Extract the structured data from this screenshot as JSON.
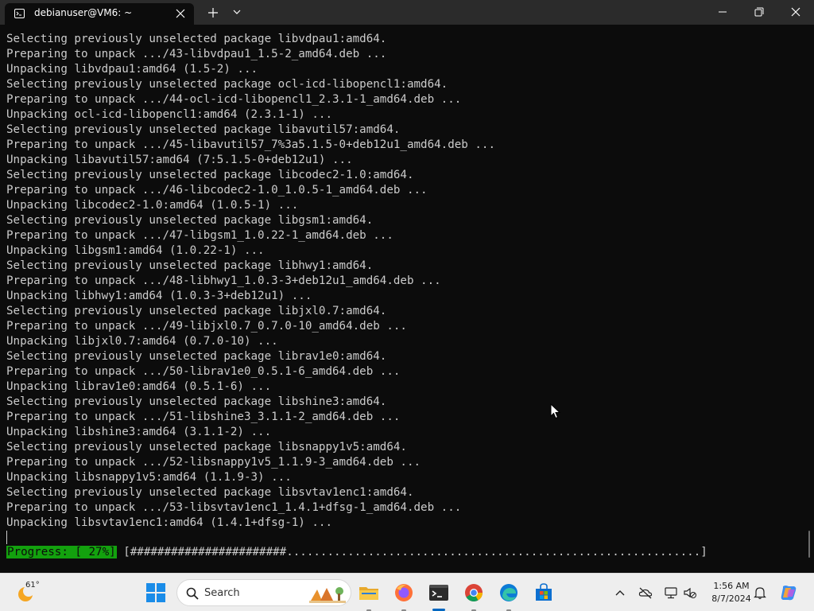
{
  "window": {
    "tab_title": "debianuser@VM6: ~"
  },
  "terminal": {
    "lines": [
      "Selecting previously unselected package libvdpau1:amd64.",
      "Preparing to unpack .../43-libvdpau1_1.5-2_amd64.deb ...",
      "Unpacking libvdpau1:amd64 (1.5-2) ...",
      "Selecting previously unselected package ocl-icd-libopencl1:amd64.",
      "Preparing to unpack .../44-ocl-icd-libopencl1_2.3.1-1_amd64.deb ...",
      "Unpacking ocl-icd-libopencl1:amd64 (2.3.1-1) ...",
      "Selecting previously unselected package libavutil57:amd64.",
      "Preparing to unpack .../45-libavutil57_7%3a5.1.5-0+deb12u1_amd64.deb ...",
      "Unpacking libavutil57:amd64 (7:5.1.5-0+deb12u1) ...",
      "Selecting previously unselected package libcodec2-1.0:amd64.",
      "Preparing to unpack .../46-libcodec2-1.0_1.0.5-1_amd64.deb ...",
      "Unpacking libcodec2-1.0:amd64 (1.0.5-1) ...",
      "Selecting previously unselected package libgsm1:amd64.",
      "Preparing to unpack .../47-libgsm1_1.0.22-1_amd64.deb ...",
      "Unpacking libgsm1:amd64 (1.0.22-1) ...",
      "Selecting previously unselected package libhwy1:amd64.",
      "Preparing to unpack .../48-libhwy1_1.0.3-3+deb12u1_amd64.deb ...",
      "Unpacking libhwy1:amd64 (1.0.3-3+deb12u1) ...",
      "Selecting previously unselected package libjxl0.7:amd64.",
      "Preparing to unpack .../49-libjxl0.7_0.7.0-10_amd64.deb ...",
      "Unpacking libjxl0.7:amd64 (0.7.0-10) ...",
      "Selecting previously unselected package librav1e0:amd64.",
      "Preparing to unpack .../50-librav1e0_0.5.1-6_amd64.deb ...",
      "Unpacking librav1e0:amd64 (0.5.1-6) ...",
      "Selecting previously unselected package libshine3:amd64.",
      "Preparing to unpack .../51-libshine3_3.1.1-2_amd64.deb ...",
      "Unpacking libshine3:amd64 (3.1.1-2) ...",
      "Selecting previously unselected package libsnappy1v5:amd64.",
      "Preparing to unpack .../52-libsnappy1v5_1.1.9-3_amd64.deb ...",
      "Unpacking libsnappy1v5:amd64 (1.1.9-3) ...",
      "Selecting previously unselected package libsvtav1enc1:amd64.",
      "Preparing to unpack .../53-libsvtav1enc1_1.4.1+dfsg-1_amd64.deb ...",
      "Unpacking libsvtav1enc1:amd64 (1.4.1+dfsg-1) ..."
    ],
    "progress_label": "Progress: [ 27%]",
    "progress_bar": " [#######################.............................................................]",
    "progress_percent": 27
  },
  "taskbar": {
    "weather_temp": "61°",
    "search_placeholder": "Search",
    "apps": [
      "file-explorer-icon",
      "firefox-icon",
      "terminal-icon",
      "chrome-icon",
      "edge-icon",
      "store-icon"
    ],
    "clock_time": "1:56 AM",
    "clock_date": "8/7/2024"
  },
  "colors": {
    "terminal_bg": "#0c0c0c",
    "terminal_fg": "#cccccc",
    "progress_green": "#13a10e",
    "titlebar_bg": "#2b2b2b",
    "taskbar_bg": "#eeeeee",
    "accent": "#0067c0"
  }
}
